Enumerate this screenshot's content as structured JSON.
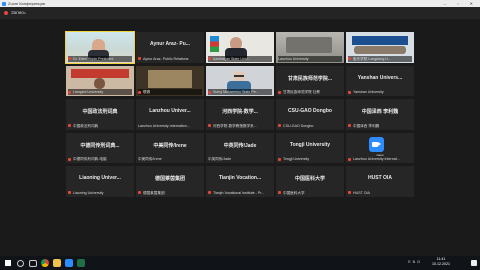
{
  "window": {
    "title": "Zoom Конференция",
    "controls": "– ▫ ✕"
  },
  "recording": {
    "label": "Запись"
  },
  "tiles": [
    {
      "label": "Dr. Eden Kirpin President",
      "mic": true,
      "kind": "video1",
      "active": true
    },
    {
      "center": "Aynur Araz- Pu...",
      "label": "Aynur Araz- Public Relations",
      "mic": true,
      "kind": "text"
    },
    {
      "label": "Azerbaijan State Univ...",
      "mic": true,
      "kind": "video3"
    },
    {
      "label": "Lanzhou University",
      "mic": false,
      "kind": "video4"
    },
    {
      "label": "陇东学院 Longdong U...",
      "mic": true,
      "kind": "video5"
    },
    {
      "label": "Liangshi University",
      "mic": true,
      "kind": "video6"
    },
    {
      "label": "联赛",
      "mic": true,
      "kind": "video7"
    },
    {
      "label": "Sumy Makarenko State Pe...",
      "mic": true,
      "kind": "video8"
    },
    {
      "center": "甘肃民族师范学院...",
      "label": "甘肃民族师范学院 社教",
      "mic": true,
      "kind": "text"
    },
    {
      "center": "Yanshan Univers...",
      "label": "Yanshan University",
      "mic": true,
      "kind": "text"
    },
    {
      "center": "中国政法刑词典",
      "label": "中国政法刑词典",
      "mic": true,
      "kind": "text"
    },
    {
      "center": "Lanzhou Univer...",
      "label": "Lanzhou University-Internation...",
      "mic": false,
      "kind": "text"
    },
    {
      "center": "河西学院-数学...",
      "label": "河西学院-数学教授数学系...",
      "mic": true,
      "kind": "text"
    },
    {
      "center": "CSU-GAO Dongbo",
      "label": "CSU-GAO Dongbo",
      "mic": true,
      "kind": "text"
    },
    {
      "center": "中国泽西 李利魏",
      "label": "中国泽西 李利魏",
      "mic": true,
      "kind": "text"
    },
    {
      "center": "中德同传刑词典...",
      "label": "中德同传刑词典-电脑",
      "mic": true,
      "kind": "text"
    },
    {
      "center": "中美同传/Irene",
      "label": "中美同传/Irene",
      "mic": false,
      "kind": "text"
    },
    {
      "center": "中英同传/Jade",
      "label": "中英同传/Jade",
      "mic": false,
      "kind": "text"
    },
    {
      "center": "Tongji University",
      "label": "Tongji University",
      "mic": true,
      "kind": "text"
    },
    {
      "label": "Lanzhou University Internat...",
      "mic": true,
      "kind": "zoom",
      "logo_text": "zoom"
    },
    {
      "center": "Liaoning Univer...",
      "label": "Liaoning University",
      "mic": true,
      "kind": "text"
    },
    {
      "center": "德国莱茵集团",
      "label": "德国莱茵集团",
      "mic": true,
      "kind": "text"
    },
    {
      "center": "Tianjin Vocation...",
      "label": "Tianjin Vocational Institute - Pr...",
      "mic": true,
      "kind": "text"
    },
    {
      "center": "中国医科大学",
      "label": "中国医科大学",
      "mic": true,
      "kind": "text"
    },
    {
      "center": "HUST OIA",
      "label": "HUST OIA",
      "mic": true,
      "kind": "text"
    }
  ],
  "taskbar": {
    "time": "11:41",
    "date": "10.12.2021",
    "tray": "ENG",
    "icons": [
      "windows-start",
      "search",
      "task-view",
      "chrome",
      "explorer",
      "zoom",
      "excel"
    ]
  }
}
